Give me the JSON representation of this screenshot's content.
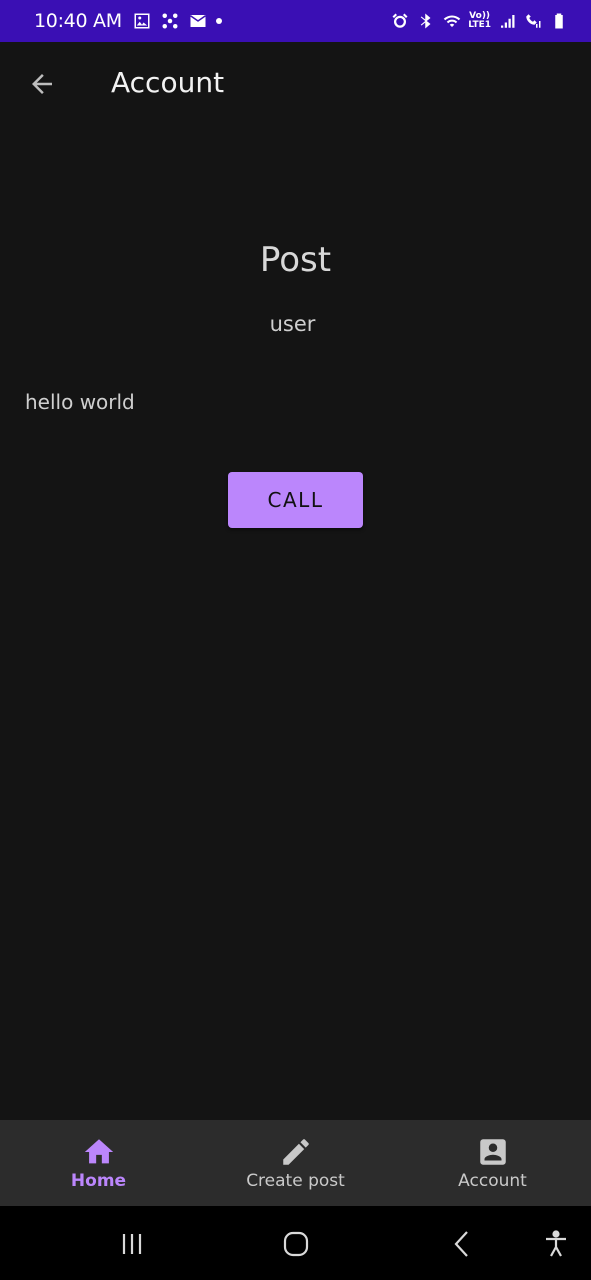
{
  "status_bar": {
    "time": "10:40 AM",
    "lte_top": "Vo))",
    "lte_bottom": "LTE1",
    "icons": [
      "image-icon",
      "fan-icon",
      "mail-icon",
      "dot-icon",
      "alarm-icon",
      "bluetooth-icon",
      "wifi-icon",
      "signal-icon",
      "call-signal-icon",
      "battery-icon"
    ]
  },
  "app_bar": {
    "title": "Account",
    "back_icon": "arrow-back-icon"
  },
  "post": {
    "title": "Post",
    "user": "user",
    "body": "hello world",
    "call_label": "CALL"
  },
  "bottom_nav": {
    "items": [
      {
        "label": "Home",
        "icon": "home-icon",
        "active": true
      },
      {
        "label": "Create post",
        "icon": "pencil-icon",
        "active": false
      },
      {
        "label": "Account",
        "icon": "account-box-icon",
        "active": false
      }
    ]
  },
  "system_nav": {
    "icons": [
      "recent-apps-icon",
      "home-circle-icon",
      "back-chevron-icon",
      "accessibility-icon"
    ]
  },
  "colors": {
    "status_bar": "#3a0fb4",
    "background": "#141414",
    "accent": "#bb86fc",
    "bottom_nav": "#2c2c2c"
  }
}
